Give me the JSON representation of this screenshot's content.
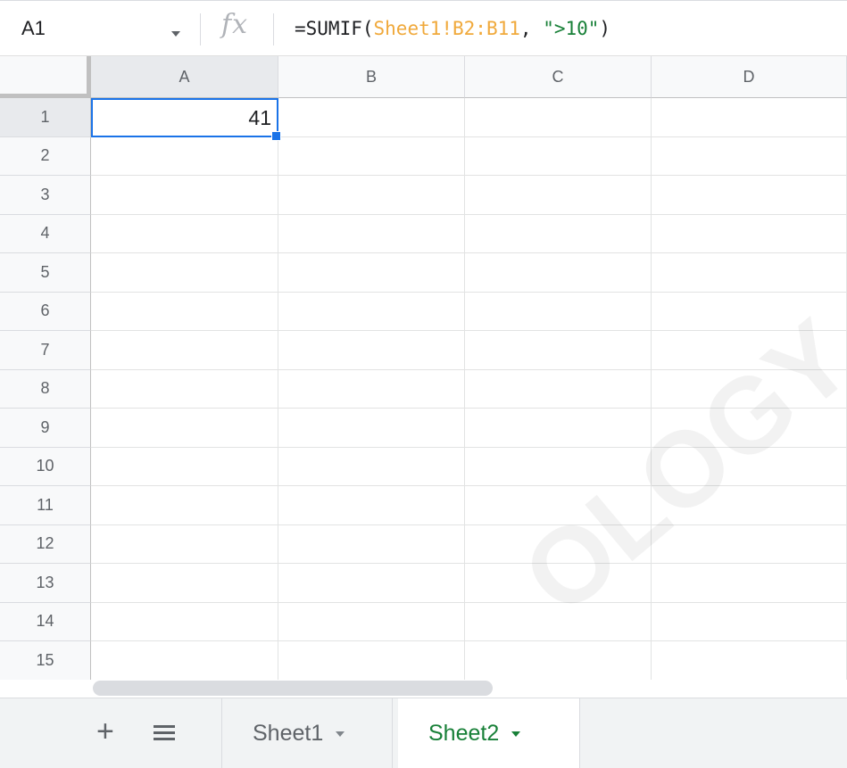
{
  "formula_bar": {
    "name_box": "A1",
    "fx_label": "fx",
    "formula_prefix": "=SUMIF(",
    "formula_ref": "Sheet1!B2:B11",
    "formula_sep": ", ",
    "formula_str": "\">10\"",
    "formula_suffix": ")"
  },
  "columns": [
    "A",
    "B",
    "C",
    "D"
  ],
  "rows": [
    "1",
    "2",
    "3",
    "4",
    "5",
    "6",
    "7",
    "8",
    "9",
    "10",
    "11",
    "12",
    "13",
    "14",
    "15"
  ],
  "cells": {
    "A1": "41"
  },
  "selected_cell": "A1",
  "sheet_tabs": [
    {
      "label": "Sheet1",
      "active": false
    },
    {
      "label": "Sheet2",
      "active": true
    }
  ],
  "icons": {
    "add_sheet": "plus-icon",
    "all_sheets": "list-icon",
    "name_box_dropdown": "caret-down-icon",
    "function": "fx-icon"
  },
  "colors": {
    "selection": "#1a73e8",
    "active_tab_text": "#188038",
    "range_reference": "#f0a93b",
    "string_literal": "#188038"
  },
  "watermark": "OLOGY"
}
